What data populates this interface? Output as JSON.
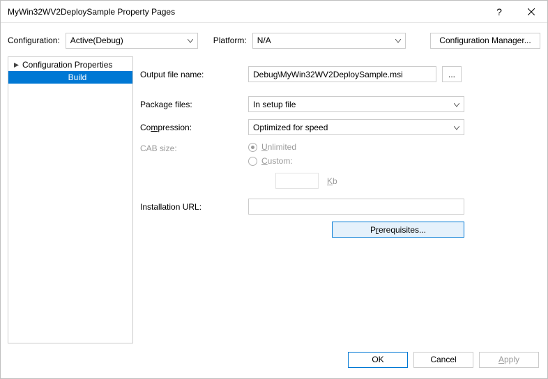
{
  "title": "MyWin32WV2DeploySample Property Pages",
  "configrow": {
    "configuration_label": "Configuration:",
    "configuration_value": "Active(Debug)",
    "platform_label": "Platform:",
    "platform_value": "N/A",
    "config_manager_button": "Configuration Manager..."
  },
  "tree": {
    "root": "Configuration Properties",
    "child": "Build"
  },
  "form": {
    "output_file_label": "Output file name:",
    "output_file_value": "Debug\\MyWin32WV2DeploySample.msi",
    "browse_button": "...",
    "package_files_label": "Package files:",
    "package_files_value": "In setup file",
    "compression_label": "Compression:",
    "compression_value": "Optimized for speed",
    "cab_size_label": "CAB size:",
    "cab_unlimited": "Unlimited",
    "cab_custom": "Custom:",
    "cab_kb": "Kb",
    "installation_url_label": "Installation URL:",
    "installation_url_value": "",
    "prerequisites_button": "Prerequisites..."
  },
  "footer": {
    "ok": "OK",
    "cancel": "Cancel",
    "apply": "Apply"
  }
}
